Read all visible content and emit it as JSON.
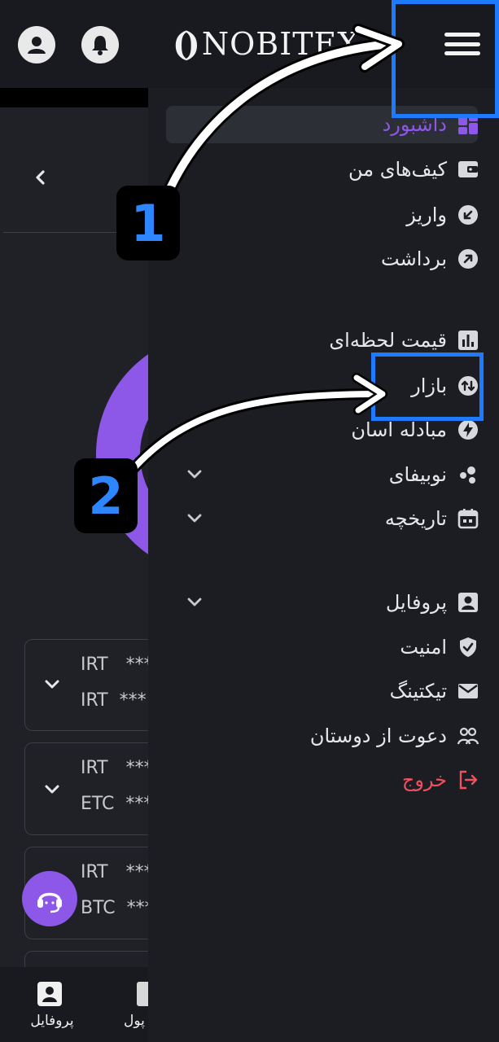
{
  "header": {
    "brand": "NOBITEX",
    "icons": [
      "user-account-icon",
      "notification-bell-icon",
      "hamburger-menu-icon"
    ]
  },
  "background_page": {
    "cards": [
      {
        "line1_currency": "IRT",
        "line1_value": "***",
        "line2_currency": "IRT",
        "line2_value": "***"
      },
      {
        "line1_currency": "IRT",
        "line1_value": "***",
        "line2_currency": "ETC",
        "line2_value": "***"
      },
      {
        "line1_currency": "IRT",
        "line1_value": "***",
        "line2_currency": "BTC",
        "line2_value": "***"
      }
    ],
    "bottom_nav": {
      "profile_label": "پروفایل",
      "wallet_label": "پول"
    }
  },
  "menu": {
    "dashboard": "داشبورد",
    "wallets": "کیف‌های من",
    "deposit": "واریز",
    "withdraw": "برداشت",
    "live_price": "قیمت لحظه‌ای",
    "market": "بازار",
    "easy_exchange": "مبادله آسان",
    "nobifi": "نوبیفای",
    "history": "تاریخچه",
    "profile": "پروفایل",
    "security": "امنیت",
    "ticketing": "تیکتینگ",
    "invite": "دعوت از دوستان",
    "logout": "خروج"
  },
  "annotations": {
    "step1": "1",
    "step2": "2"
  },
  "colors": {
    "accent": "#8d58e8",
    "danger": "#f0515e",
    "annotation_blue": "#1e7bff"
  }
}
